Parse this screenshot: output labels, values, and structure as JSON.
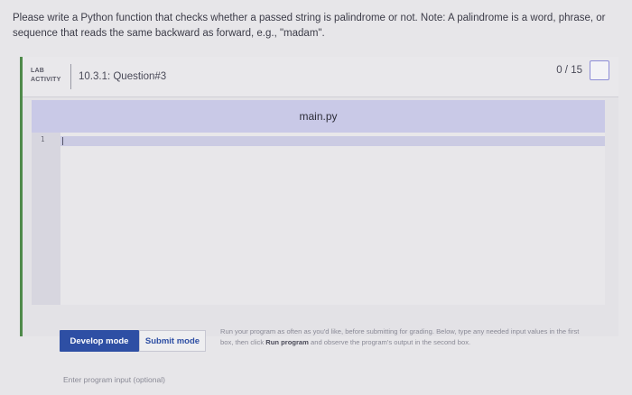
{
  "prompt": {
    "text": "Please write a Python function that checks whether a passed string is palindrome or not. Note: A palindrome is a word, phrase, or sequence that reads the same backward as forward, e.g., \"madam\"."
  },
  "lab": {
    "badge_line1": "LAB",
    "badge_line2": "ACTIVITY",
    "title": "10.3.1: Question#3",
    "score": "0 / 15"
  },
  "editor": {
    "filename": "main.py",
    "line_number": "1"
  },
  "controls": {
    "develop_mode": "Develop mode",
    "submit_mode": "Submit mode",
    "help_text_1": "Run your program as often as you'd like, before submitting for grading. Below, type any needed input values in the first box, then click ",
    "help_bold": "Run program",
    "help_text_2": " and observe the program's output in the second box.",
    "input_label": "Enter program input (optional)"
  },
  "colors": {
    "accent": "#2e4fa4",
    "lab_stripe": "#4f8a4a",
    "tab_bar": "#c9c9e7"
  }
}
